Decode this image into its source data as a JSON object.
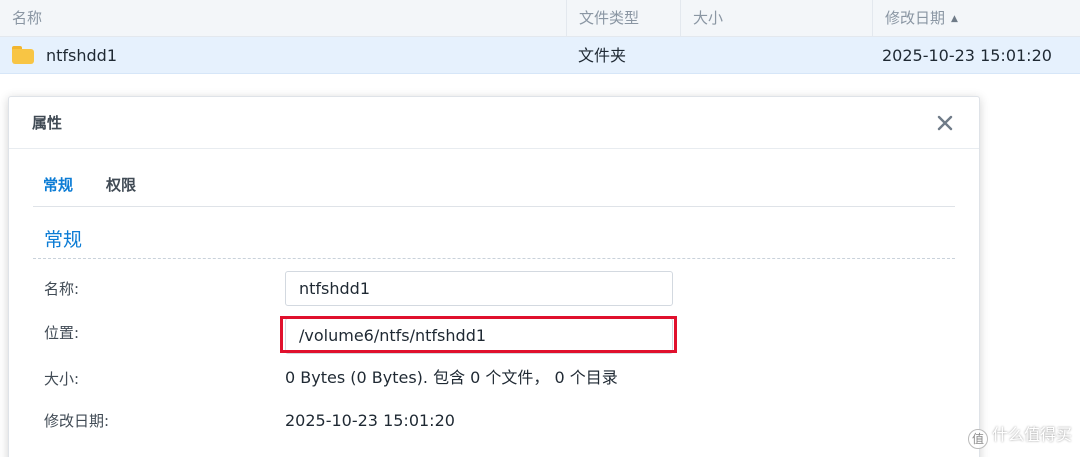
{
  "file_list": {
    "columns": {
      "name": "名称",
      "type": "文件类型",
      "size": "大小",
      "modified": "修改日期"
    },
    "sort_column": "modified",
    "sort_direction": "ascending",
    "rows": [
      {
        "name": "ntfshdd1",
        "type": "文件夹",
        "size": "",
        "modified": "2025-10-23 15:01:20",
        "icon": "folder-icon"
      }
    ]
  },
  "dialog": {
    "title": "属性",
    "close_icon": "close-icon",
    "tabs": [
      {
        "label": "常规",
        "active": true
      },
      {
        "label": "权限",
        "active": false
      }
    ],
    "section_title": "常规",
    "fields": {
      "name_label": "名称:",
      "name_value": "ntfshdd1",
      "location_label": "位置:",
      "location_value": "/volume6/ntfs/ntfshdd1",
      "size_label": "大小:",
      "size_value": "0 Bytes (0 Bytes). 包含 0 个文件， 0 个目录",
      "modified_label": "修改日期:",
      "modified_value": "2025-10-23 15:01:20"
    }
  },
  "watermark": {
    "badge": "值",
    "text": "什么值得买"
  },
  "colors": {
    "accent": "#0c7cd5",
    "highlight_border": "#e0102d",
    "selected_row": "#e6f1fd",
    "folder": "#f8c544"
  }
}
